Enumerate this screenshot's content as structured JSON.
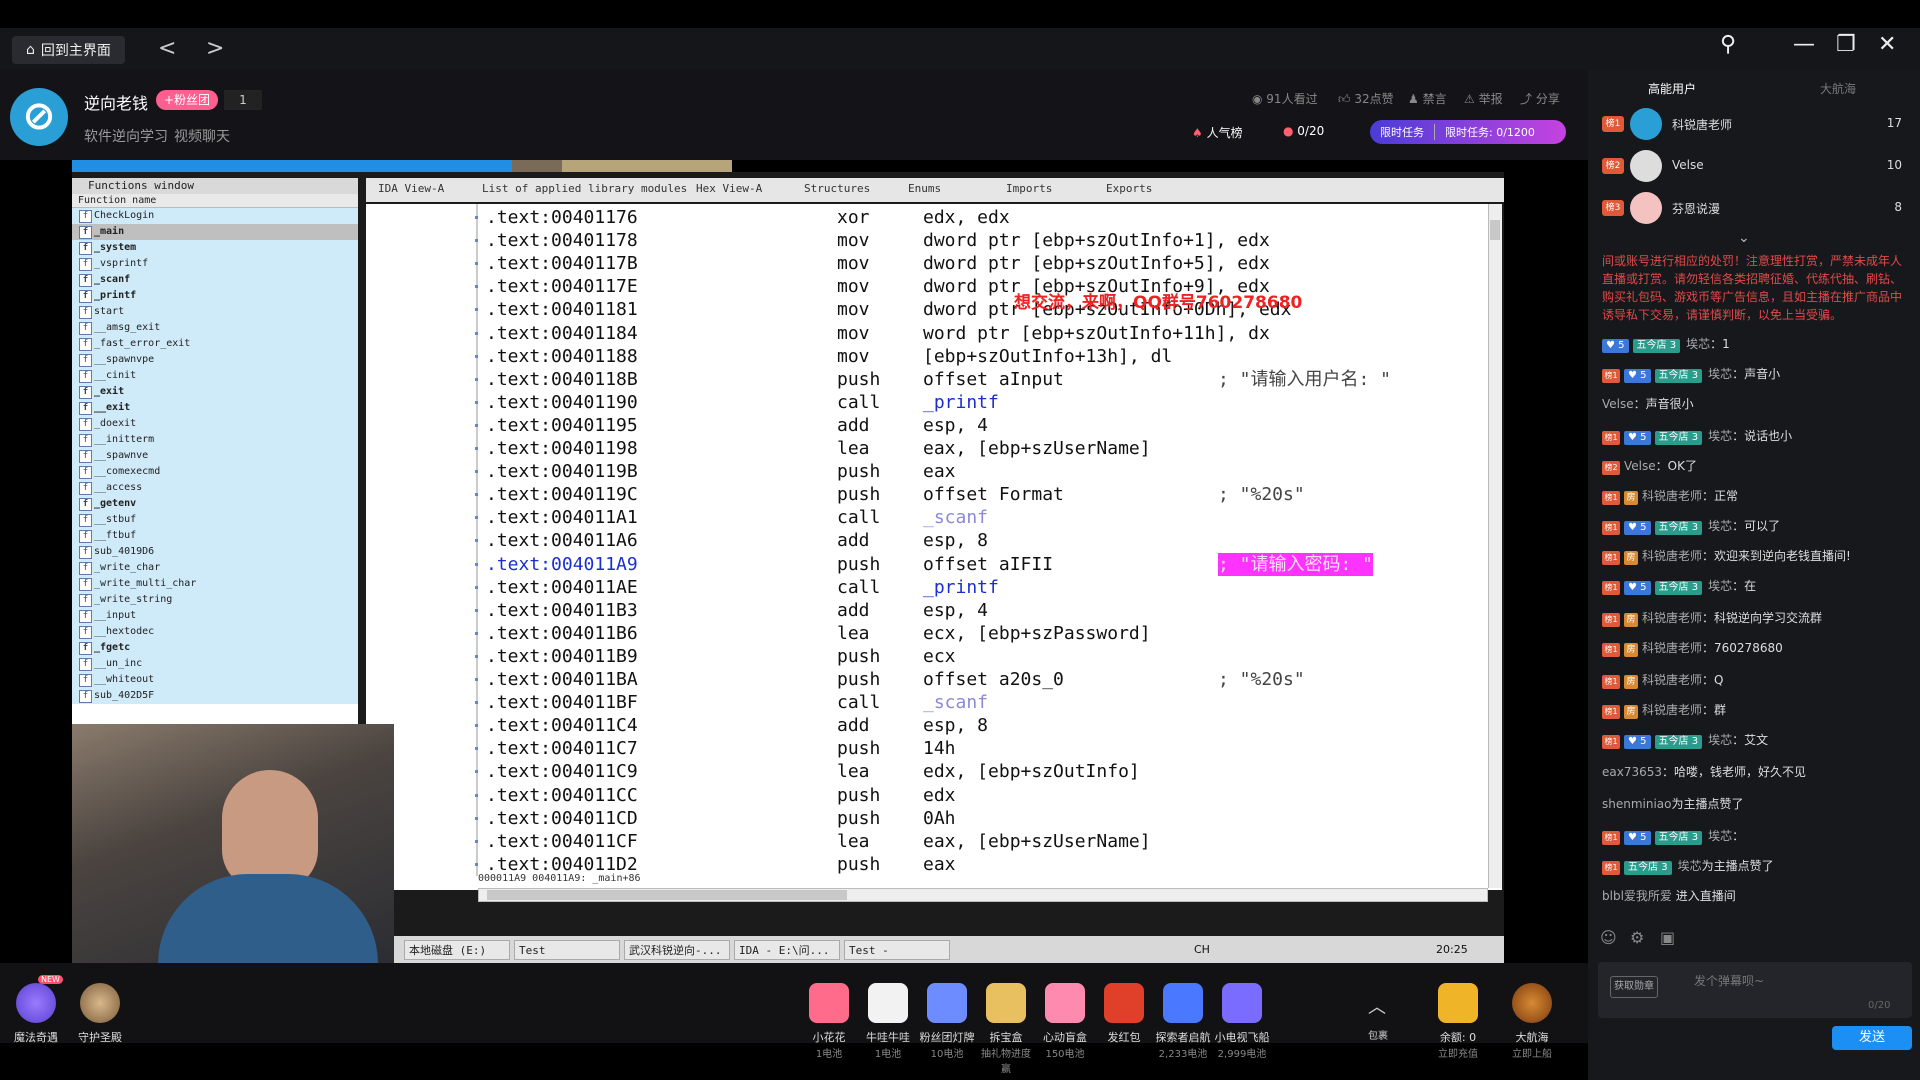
{
  "app": {
    "home_label": "回到主界面",
    "back": "<",
    "forward": ">"
  },
  "streamer": {
    "name": "逆向老钱",
    "fan_badge": "+粉丝团",
    "fan_count": "1",
    "tag1": "软件逆向学习",
    "tag2": "视频聊天"
  },
  "stats": {
    "watched": "91人看过",
    "likes": "32点赞",
    "block": "禁言",
    "report": "举报",
    "share": "分享"
  },
  "hot_label": "人气榜",
  "progress": "0/20",
  "task_label": "限时任务",
  "task_value": "限时任务: 0/1200",
  "sidebar": {
    "tab1": "高能用户",
    "tab2": "大航海",
    "ranks": [
      {
        "badge": "榜1",
        "name": "科锐唐老师",
        "score": "17"
      },
      {
        "badge": "榜2",
        "name": "Velse",
        "score": "10"
      },
      {
        "badge": "榜3",
        "name": "芬恩说漫",
        "score": "8"
      }
    ],
    "notice": "间或账号进行相应的处罚！注意理性打赏，严禁未成年人直播或打赏。请勿轻信各类招聘征婚、代练代抽、刷钻、购买礼包码、游戏币等广告信息，且如主播在推广商品中诱导私下交易，请谨慎判断，以免上当受骗。",
    "messages": [
      {
        "v": "5",
        "club": "五今店",
        "lvl": "3",
        "user": "埃芯",
        "text": "：1"
      },
      {
        "lv": "榜1",
        "v": "5",
        "club": "五今店",
        "lvl": "3",
        "user": "埃芯",
        "text": "：声音小"
      },
      {
        "user": "Velse",
        "text": "：声音很小"
      },
      {
        "lv": "榜1",
        "v": "5",
        "club": "五今店",
        "lvl": "3",
        "user": "埃芯",
        "text": "：说话也小"
      },
      {
        "lv": "榜2",
        "user": "Velse",
        "text": "：OK了"
      },
      {
        "lv": "榜1",
        "fang": "房",
        "user": "科锐唐老师",
        "text": "：正常"
      },
      {
        "lv": "榜1",
        "v": "5",
        "club": "五今店",
        "lvl": "3",
        "user": "埃芯",
        "text": "：可以了"
      },
      {
        "lv": "榜1",
        "fang": "房",
        "user": "科锐唐老师",
        "text": "：欢迎来到逆向老钱直播间!"
      },
      {
        "lv": "榜1",
        "v": "5",
        "club": "五今店",
        "lvl": "3",
        "user": "埃芯",
        "text": "：在"
      },
      {
        "lv": "榜1",
        "fang": "房",
        "user": "科锐唐老师",
        "text": "：科锐逆向学习交流群"
      },
      {
        "lv": "榜1",
        "fang": "房",
        "user": "科锐唐老师",
        "text": "：760278680"
      },
      {
        "lv": "榜1",
        "fang": "房",
        "user": "科锐唐老师",
        "text": "：Q"
      },
      {
        "lv": "榜1",
        "fang": "房",
        "user": "科锐唐老师",
        "text": "：群"
      },
      {
        "lv": "榜1",
        "v": "5",
        "club": "五今店",
        "lvl": "3",
        "user": "埃芯",
        "text": "：艾文"
      },
      {
        "user": "eax73653",
        "text": "：哈喽，钱老师，好久不见"
      },
      {
        "user": "shenminiao",
        "text": "为主播点赞了"
      },
      {
        "lv": "榜1",
        "v": "5",
        "club": "五今店",
        "lvl": "3",
        "user": "埃芯",
        "text": "："
      },
      {
        "lv": "榜1",
        "club": "五今店",
        "lvl": "3",
        "user": "埃芯",
        "text": "为主播点赞了"
      },
      {
        "user": "blbl爱我所爱",
        "text": " 进入直播间"
      }
    ],
    "input_placeholder": "发个弹幕呗~",
    "input_count": "0/20",
    "send": "发送",
    "fetch_badge": "获取勋章"
  },
  "ida": {
    "functions_title": "Functions window",
    "functions_header": "Function name",
    "functions": [
      {
        "n": "CheckLogin",
        "b": false
      },
      {
        "n": "_main",
        "b": true,
        "sel": true
      },
      {
        "n": "_system",
        "b": true
      },
      {
        "n": "_vsprintf",
        "b": false
      },
      {
        "n": "_scanf",
        "b": true
      },
      {
        "n": "_printf",
        "b": true
      },
      {
        "n": "start",
        "b": false
      },
      {
        "n": "__amsg_exit",
        "b": false
      },
      {
        "n": "_fast_error_exit",
        "b": false
      },
      {
        "n": "__spawnvpe",
        "b": false
      },
      {
        "n": "__cinit",
        "b": false
      },
      {
        "n": "_exit",
        "b": true
      },
      {
        "n": "__exit",
        "b": true
      },
      {
        "n": "_doexit",
        "b": false
      },
      {
        "n": "__initterm",
        "b": false
      },
      {
        "n": "__spawnve",
        "b": false
      },
      {
        "n": "__comexecmd",
        "b": false
      },
      {
        "n": "__access",
        "b": false
      },
      {
        "n": "_getenv",
        "b": true
      },
      {
        "n": "__stbuf",
        "b": false
      },
      {
        "n": "__ftbuf",
        "b": false
      },
      {
        "n": "sub_4019D6",
        "b": false
      },
      {
        "n": "_write_char",
        "b": false
      },
      {
        "n": "_write_multi_char",
        "b": false
      },
      {
        "n": "_write_string",
        "b": false
      },
      {
        "n": "__input",
        "b": false
      },
      {
        "n": "__hextodec",
        "b": false
      },
      {
        "n": "_fgetc",
        "b": true
      },
      {
        "n": "__un_inc",
        "b": false
      },
      {
        "n": "__whiteout",
        "b": false
      },
      {
        "n": "sub_402D5F",
        "b": false
      }
    ],
    "tabs": [
      "IDA View-A",
      "List of applied library modules",
      "Hex View-A",
      "Structures",
      "Enums",
      "Imports",
      "Exports"
    ],
    "lines": [
      {
        "a": ".text:00401176",
        "m": "xor",
        "o": "edx, edx",
        "c": ""
      },
      {
        "a": ".text:00401178",
        "m": "mov",
        "o": "dword ptr [ebp+szOutInfo+1], edx",
        "c": ""
      },
      {
        "a": ".text:0040117B",
        "m": "mov",
        "o": "dword ptr [ebp+szOutInfo+5], edx",
        "c": ""
      },
      {
        "a": ".text:0040117E",
        "m": "mov",
        "o": "dword ptr [ebp+szOutInfo+9], edx",
        "c": ""
      },
      {
        "a": ".text:00401181",
        "m": "mov",
        "o": "dword ptr [ebp+szOutInfo+0Dh], edx",
        "c": ""
      },
      {
        "a": ".text:00401184",
        "m": "mov",
        "o": "word ptr [ebp+szOutInfo+11h], dx",
        "c": ""
      },
      {
        "a": ".text:00401188",
        "m": "mov",
        "o": "[ebp+szOutInfo+13h], dl",
        "c": ""
      },
      {
        "a": ".text:0040118B",
        "m": "push",
        "o": "offset aInput",
        "c": "; \"请输入用户名: \""
      },
      {
        "a": ".text:00401190",
        "m": "call",
        "o": "_printf",
        "c": ""
      },
      {
        "a": ".text:00401195",
        "m": "add",
        "o": "esp, 4",
        "c": ""
      },
      {
        "a": ".text:00401198",
        "m": "lea",
        "o": "eax, [ebp+szUserName]",
        "c": ""
      },
      {
        "a": ".text:0040119B",
        "m": "push",
        "o": "eax",
        "c": ""
      },
      {
        "a": ".text:0040119C",
        "m": "push",
        "o": "offset Format",
        "c": "; \"%20s\""
      },
      {
        "a": ".text:004011A1",
        "m": "call",
        "o": "_scanf",
        "c": ""
      },
      {
        "a": ".text:004011A6",
        "m": "add",
        "o": "esp, 8",
        "c": ""
      },
      {
        "a": ".text:004011A9",
        "m": "push",
        "o": "offset aIFII",
        "c": "; \"请输入密码: \""
      },
      {
        "a": ".text:004011AE",
        "m": "call",
        "o": "_printf",
        "c": ""
      },
      {
        "a": ".text:004011B3",
        "m": "add",
        "o": "esp, 4",
        "c": ""
      },
      {
        "a": ".text:004011B6",
        "m": "lea",
        "o": "ecx, [ebp+szPassword]",
        "c": ""
      },
      {
        "a": ".text:004011B9",
        "m": "push",
        "o": "ecx",
        "c": ""
      },
      {
        "a": ".text:004011BA",
        "m": "push",
        "o": "offset a20s_0",
        "c": "; \"%20s\""
      },
      {
        "a": ".text:004011BF",
        "m": "call",
        "o": "_scanf",
        "c": ""
      },
      {
        "a": ".text:004011C4",
        "m": "add",
        "o": "esp, 8",
        "c": ""
      },
      {
        "a": ".text:004011C7",
        "m": "push",
        "o": "14h",
        "c": ""
      },
      {
        "a": ".text:004011C9",
        "m": "lea",
        "o": "edx, [ebp+szOutInfo]",
        "c": ""
      },
      {
        "a": ".text:004011CC",
        "m": "push",
        "o": "edx",
        "c": ""
      },
      {
        "a": ".text:004011CD",
        "m": "push",
        "o": "0Ah",
        "c": ""
      },
      {
        "a": ".text:004011CF",
        "m": "lea",
        "o": "eax, [ebp+szUserName]",
        "c": ""
      },
      {
        "a": ".text:004011D2",
        "m": "push",
        "o": "eax",
        "c": ""
      }
    ],
    "overlay": "想交流，来啊，QQ群号760278680",
    "status": "000011A9 004011A9: _main+86",
    "taskbar": [
      "本地磁盘 (E:)",
      "Test",
      "武汉科锐逆向-...",
      "IDA - E:\\问...",
      "Test - Micros..."
    ],
    "ch": "CH",
    "clock": "20:25"
  },
  "bottom": {
    "left": [
      {
        "name": "魔法奇遇",
        "badge": "NEW"
      },
      {
        "name": "守护圣殿"
      }
    ],
    "gifts": [
      {
        "name": "小花花",
        "sub": "1电池"
      },
      {
        "name": "牛哇牛哇",
        "sub": "1电池"
      },
      {
        "name": "粉丝团灯牌",
        "sub": "10电池"
      },
      {
        "name": "拆宝盒",
        "sub": "抽礼物进度赢"
      },
      {
        "name": "心动盲盒",
        "sub": "150电池"
      },
      {
        "name": "发红包",
        "sub": ""
      },
      {
        "name": "探索者启航",
        "sub": "2,233电池"
      },
      {
        "name": "小电视飞船",
        "sub": "2,999电池"
      }
    ],
    "more": "包裹",
    "balance": "余额: 0",
    "balance_sub": "立即充值",
    "voyage": "大航海",
    "voyage_sub": "立即上船"
  },
  "colors": {
    "accent": "#1c8ff5",
    "pink": "#ff5f8f",
    "sidebar": "#17181c"
  }
}
